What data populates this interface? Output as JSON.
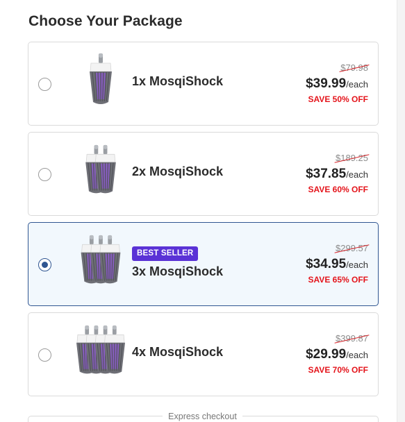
{
  "page": {
    "title": "Choose Your Package"
  },
  "packages": [
    {
      "name": "1x MosqiShock",
      "old_price": "$79.98",
      "price": "$39.99",
      "per": "/each",
      "save": "SAVE 50% OFF",
      "selected": false,
      "badge": "",
      "image": "mosquito-lamp-icon"
    },
    {
      "name": "2x MosqiShock",
      "old_price": "$189.25",
      "price": "$37.85",
      "per": "/each",
      "save": "SAVE 60% OFF",
      "selected": false,
      "badge": "",
      "image": "mosquito-lamp-icon"
    },
    {
      "name": "3x MosqiShock",
      "old_price": "$299.57",
      "price": "$34.95",
      "per": "/each",
      "save": "SAVE 65% OFF",
      "selected": true,
      "badge": "BEST SELLER",
      "image": "mosquito-lamp-icon"
    },
    {
      "name": "4x MosqiShock",
      "old_price": "$399.87",
      "price": "$29.99",
      "per": "/each",
      "save": "SAVE 70% OFF",
      "selected": false,
      "badge": "",
      "image": "mosquito-lamp-icon"
    }
  ],
  "footer": {
    "express_label": "Express checkout"
  },
  "colors": {
    "accent": "#2f5591",
    "badge": "#5a32d6",
    "save": "#e4141b",
    "selected_bg": "#f2f8fd",
    "lamp_purple": "#8a5cc7"
  }
}
